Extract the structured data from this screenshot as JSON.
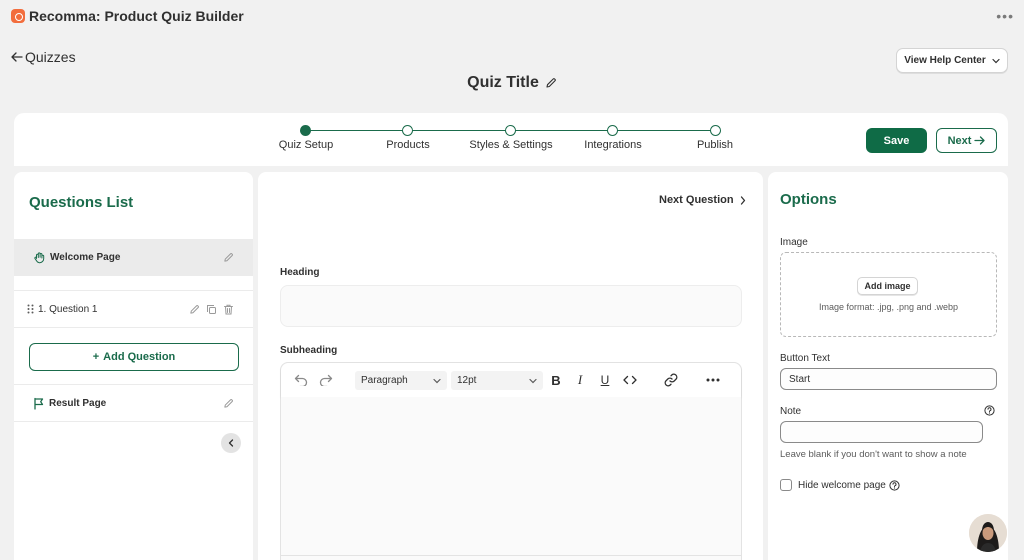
{
  "app": {
    "title": "Recomma: Product Quiz Builder",
    "more_icon": "more-horizontal-icon"
  },
  "nav": {
    "back_label": "Quizzes",
    "help_label": "View Help Center"
  },
  "quiz": {
    "title": "Quiz Title"
  },
  "stepper": {
    "steps": [
      {
        "label": "Quiz Setup",
        "active": true
      },
      {
        "label": "Products",
        "active": false
      },
      {
        "label": "Styles & Settings",
        "active": false
      },
      {
        "label": "Integrations",
        "active": false
      },
      {
        "label": "Publish",
        "active": false
      }
    ],
    "save_label": "Save",
    "next_label": "Next"
  },
  "questions": {
    "title": "Questions List",
    "welcome_label": "Welcome Page",
    "items": [
      {
        "label": "1. Question 1"
      }
    ],
    "add_label": "Add Question",
    "result_label": "Result Page"
  },
  "editor": {
    "next_question_label": "Next Question",
    "heading_label": "Heading",
    "heading_value": "",
    "subheading_label": "Subheading",
    "block_format": "Paragraph",
    "font_size": "12pt"
  },
  "options": {
    "title": "Options",
    "image_label": "Image",
    "add_image_label": "Add image",
    "image_format_text": "Image format: .jpg, .png and .webp",
    "button_text_label": "Button Text",
    "button_text_value": "Start",
    "note_label": "Note",
    "note_value": "",
    "note_help": "Leave blank if you don't want to show a note",
    "hide_welcome_label": "Hide welcome page",
    "hide_welcome_checked": false
  },
  "colors": {
    "brand_green": "#1a6b4b",
    "save_green": "#0f6b46",
    "app_icon": "#f26d3d"
  }
}
